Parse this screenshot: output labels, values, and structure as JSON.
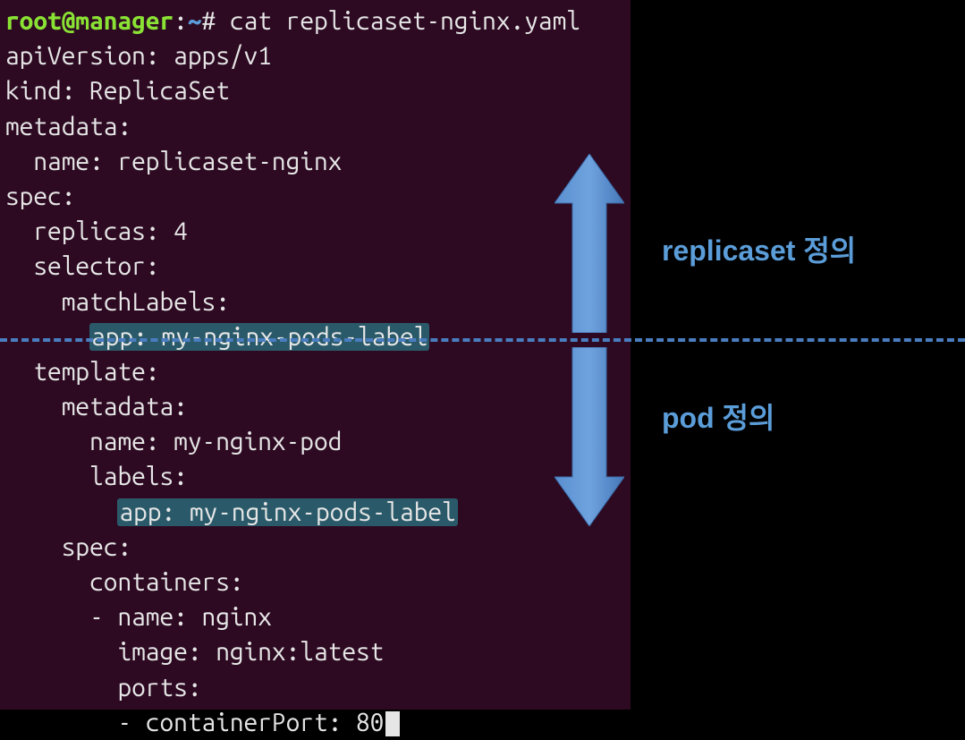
{
  "prompt": {
    "user": "root@manager",
    "path": "~",
    "symbol": "#"
  },
  "command": "cat replicaset-nginx.yaml",
  "yaml": {
    "line1": "apiVersion: apps/v1",
    "line2": "kind: ReplicaSet",
    "line3": "metadata:",
    "line4": "  name: replicaset-nginx",
    "line5": "spec:",
    "line6": "  replicas: 4",
    "line7": "  selector:",
    "line8": "    matchLabels:",
    "line9_pre": "      ",
    "line9_hl": "app: my-nginx-pods-label",
    "line10": "  template:",
    "line11": "    metadata:",
    "line12": "      name: my-nginx-pod",
    "line13": "      labels:",
    "line14_pre": "        ",
    "line14_hl": "app: my-nginx-pods-label",
    "line15": "    spec:",
    "line16": "      containers:",
    "line17": "      - name: nginx",
    "line18": "        image: nginx:latest",
    "line19": "        ports:",
    "line20": "        - containerPort: 80"
  },
  "annotations": {
    "top": "replicaset 정의",
    "bottom": "pod 정의"
  }
}
